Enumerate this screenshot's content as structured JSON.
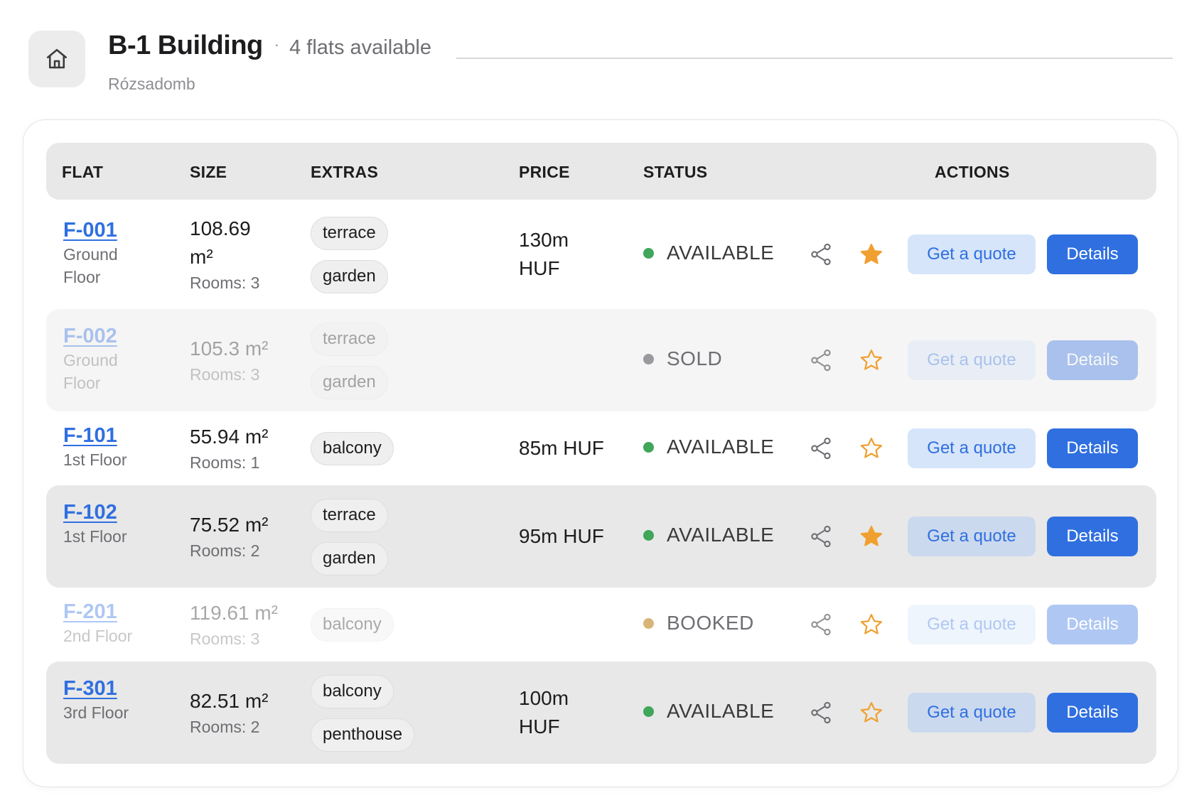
{
  "header": {
    "building_name": "B-1 Building",
    "separator": "·",
    "flats_available": "4 flats available",
    "district": "Rózsadomb"
  },
  "table": {
    "columns": [
      "FLAT",
      "SIZE",
      "EXTRAS",
      "PRICE",
      "STATUS",
      "ACTIONS"
    ],
    "rows": [
      {
        "id": "F-001",
        "floor": "Ground Floor",
        "size": "108.69 m²",
        "rooms": "Rooms: 3",
        "extras": [
          "terrace",
          "garden"
        ],
        "price": "130m HUF",
        "status": "AVAILABLE",
        "favorite": true,
        "disabled": false
      },
      {
        "id": "F-002",
        "floor": "Ground Floor",
        "size": "105.3 m²",
        "rooms": "Rooms: 3",
        "extras": [
          "terrace",
          "garden"
        ],
        "price": "",
        "status": "SOLD",
        "favorite": false,
        "disabled": true
      },
      {
        "id": "F-101",
        "floor": "1st Floor",
        "size": "55.94 m²",
        "rooms": "Rooms: 1",
        "extras": [
          "balcony"
        ],
        "price": "85m HUF",
        "status": "AVAILABLE",
        "favorite": false,
        "disabled": false
      },
      {
        "id": "F-102",
        "floor": "1st Floor",
        "size": "75.52 m²",
        "rooms": "Rooms: 2",
        "extras": [
          "terrace",
          "garden"
        ],
        "price": "95m HUF",
        "status": "AVAILABLE",
        "favorite": true,
        "disabled": false
      },
      {
        "id": "F-201",
        "floor": "2nd Floor",
        "size": "119.61 m²",
        "rooms": "Rooms: 3",
        "extras": [
          "balcony"
        ],
        "price": "",
        "status": "BOOKED",
        "favorite": false,
        "disabled": true
      },
      {
        "id": "F-301",
        "floor": "3rd Floor",
        "size": "82.51 m²",
        "rooms": "Rooms: 2",
        "extras": [
          "balcony",
          "penthouse"
        ],
        "price": "100m HUF",
        "status": "AVAILABLE",
        "favorite": false,
        "disabled": false
      }
    ]
  },
  "actions": {
    "quote_label": "Get a quote",
    "details_label": "Details"
  },
  "icons": {
    "home": "home-icon",
    "share": "share-icon",
    "star_filled": "star-filled-icon",
    "star_outline": "star-outline-icon"
  },
  "colors": {
    "accent": "#2f6fe0",
    "quote_bg": "#d6e5fa",
    "available": "#3fa65a",
    "sold": "#9a9a9e",
    "booked": "#d8b478",
    "star": "#f0a030"
  }
}
